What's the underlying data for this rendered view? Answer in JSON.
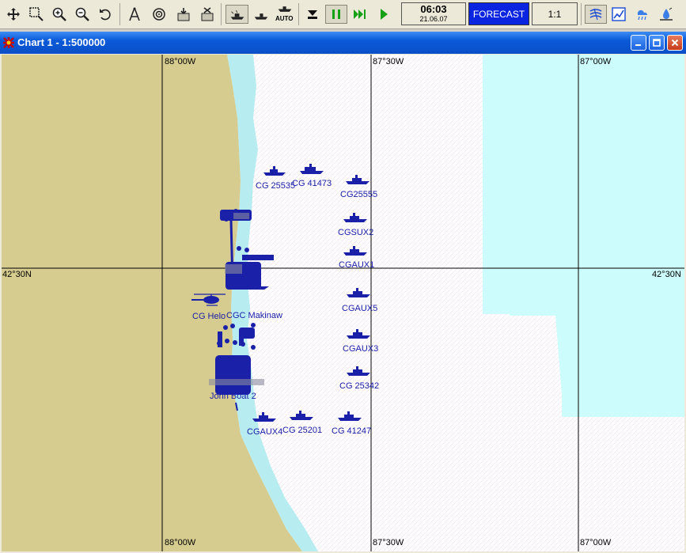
{
  "toolbar": {
    "buttons": [
      {
        "name": "move-icon"
      },
      {
        "name": "zoom-window-icon"
      },
      {
        "name": "zoom-in-icon"
      },
      {
        "name": "zoom-out-icon"
      },
      {
        "name": "undo-zoom-icon"
      },
      {
        "name": "compass-icon"
      },
      {
        "name": "target-icon"
      },
      {
        "name": "import-icon"
      },
      {
        "name": "export-icon"
      },
      {
        "name": "vessel-track-icon"
      },
      {
        "name": "vessel-icon"
      },
      {
        "name": "auto-vessel-icon"
      },
      {
        "name": "stop-icon"
      },
      {
        "name": "pause-icon"
      },
      {
        "name": "fast-forward-icon"
      },
      {
        "name": "play-icon"
      },
      {
        "name": "wind-icon"
      },
      {
        "name": "graph-icon"
      },
      {
        "name": "weather-icon"
      },
      {
        "name": "drift-icon"
      }
    ],
    "auto_label": "AUTO",
    "clock_time": "06:03",
    "clock_date": "21.06.07",
    "forecast_label": "FORECAST",
    "scale_label": "1:1"
  },
  "window": {
    "title": "Chart 1 - 1:500000"
  },
  "chart": {
    "colors": {
      "land": "#d6cc8f",
      "water": "#ffffff",
      "shallow": "#b7ecf0",
      "offshore": "#ccfcfc",
      "vessel": "#1a20a8"
    },
    "grid_labels": {
      "lon_88_top": "88°00W",
      "lon_8730_top": "87°30W",
      "lon_87_top": "87°00W",
      "lon_88_bottom": "88°00W",
      "lon_8730_bottom": "87°30W",
      "lon_87_bottom": "87°00W",
      "lat_left": "42°30N",
      "lat_right": "42°30N"
    },
    "vessels": [
      {
        "id": "v1",
        "label": "CG 25535"
      },
      {
        "id": "v2",
        "label": "CG 41473"
      },
      {
        "id": "v3",
        "label": "CG25555"
      },
      {
        "id": "v4",
        "label": "CGSUX2"
      },
      {
        "id": "v5",
        "label": "CGAUX1"
      },
      {
        "id": "v6",
        "label": "CGAUX5"
      },
      {
        "id": "v7",
        "label": "CGAUX3"
      },
      {
        "id": "v8",
        "label": "CG 25342"
      },
      {
        "id": "v9",
        "label": "CGAUX4"
      },
      {
        "id": "v10",
        "label": "CG 25201"
      },
      {
        "id": "v11",
        "label": "CG 41247"
      },
      {
        "id": "v12",
        "label": "CG Helo"
      },
      {
        "id": "v13",
        "label": "CGC Makinaw"
      },
      {
        "id": "v14",
        "label": "John Boat 2"
      }
    ]
  }
}
